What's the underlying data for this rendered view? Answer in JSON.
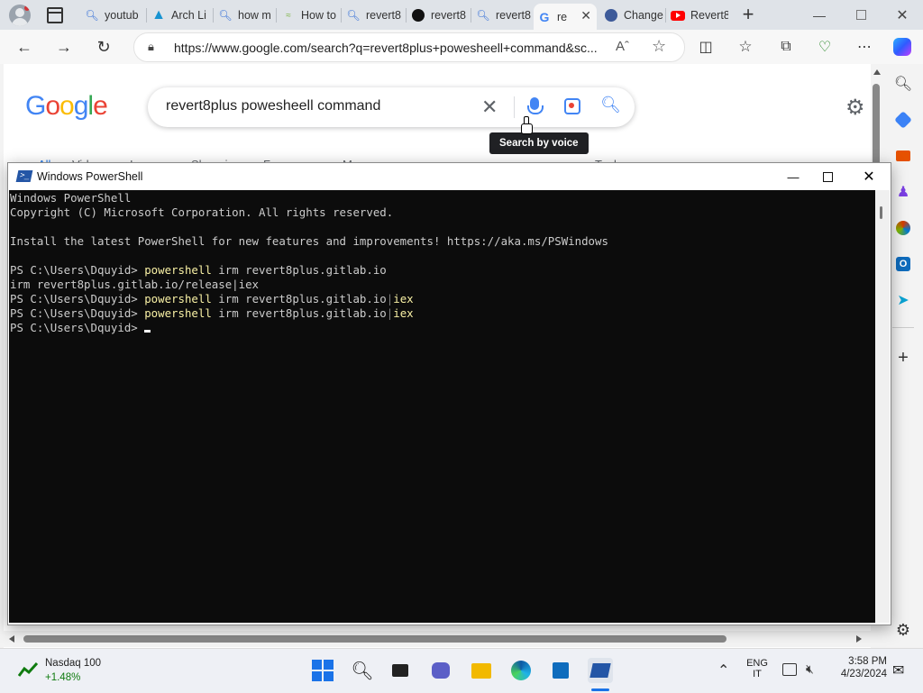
{
  "browser": {
    "tabs": [
      {
        "label": "youtub",
        "icon": "search-icon"
      },
      {
        "label": "Arch Li",
        "icon": "arch-icon"
      },
      {
        "label": "how m",
        "icon": "search-icon"
      },
      {
        "label": "How to",
        "icon": "site-icon"
      },
      {
        "label": "revert8",
        "icon": "search-icon"
      },
      {
        "label": "revert8",
        "icon": "github-icon"
      },
      {
        "label": "revert8",
        "icon": "search-icon"
      },
      {
        "label": "re",
        "icon": "google-icon",
        "active": true
      },
      {
        "label": "Change",
        "icon": "site-icon"
      },
      {
        "label": "Revert8",
        "icon": "youtube-icon"
      }
    ],
    "url": "https://www.google.com/search?q=revert8plus+powesheell+command&sc..."
  },
  "google": {
    "logo": "Google",
    "query": "revert8plus powesheell command",
    "tooltip": "Search by voice",
    "tabs": [
      "All",
      "Videos",
      "Images",
      "Shopping",
      "Forums",
      "More",
      "Tools"
    ]
  },
  "powershell": {
    "title": "Windows PowerShell",
    "lines": [
      {
        "prompt": "Windows PowerShell"
      },
      {
        "prompt": "Copyright (C) Microsoft Corporation. All rights reserved."
      },
      {
        "prompt": ""
      },
      {
        "prompt": "Install the latest PowerShell for new features and improvements! https://aka.ms/PSWindows"
      },
      {
        "prompt": ""
      },
      {
        "prompt": "PS C:\\Users\\Dquyid> ",
        "cmd": "powershell",
        "rest": " irm revert8plus.gitlab.io"
      },
      {
        "prompt": "irm revert8plus.gitlab.io/release|iex"
      },
      {
        "prompt": "PS C:\\Users\\Dquyid> ",
        "cmd": "powershell",
        "rest": " irm revert8plus.gitlab.io",
        "pipe": "|",
        "tail": "iex"
      },
      {
        "prompt": "PS C:\\Users\\Dquyid> ",
        "cmd": "powershell",
        "rest": " irm revert8plus.gitlab.io",
        "pipe": "|",
        "tail": "iex"
      },
      {
        "prompt": "PS C:\\Users\\Dquyid> "
      }
    ]
  },
  "taskbar": {
    "stock_name": "Nasdaq 100",
    "stock_change": "+1.48%",
    "lang": "ENG",
    "region": "IT",
    "time": "3:58 PM",
    "date": "4/23/2024"
  },
  "colors": {
    "ps_bg": "#0c0c0c",
    "ps_text": "#cccccc",
    "ps_cmd": "#f9f1a5",
    "stock_up": "#0f7b0f",
    "tooltip_bg": "#202124"
  }
}
